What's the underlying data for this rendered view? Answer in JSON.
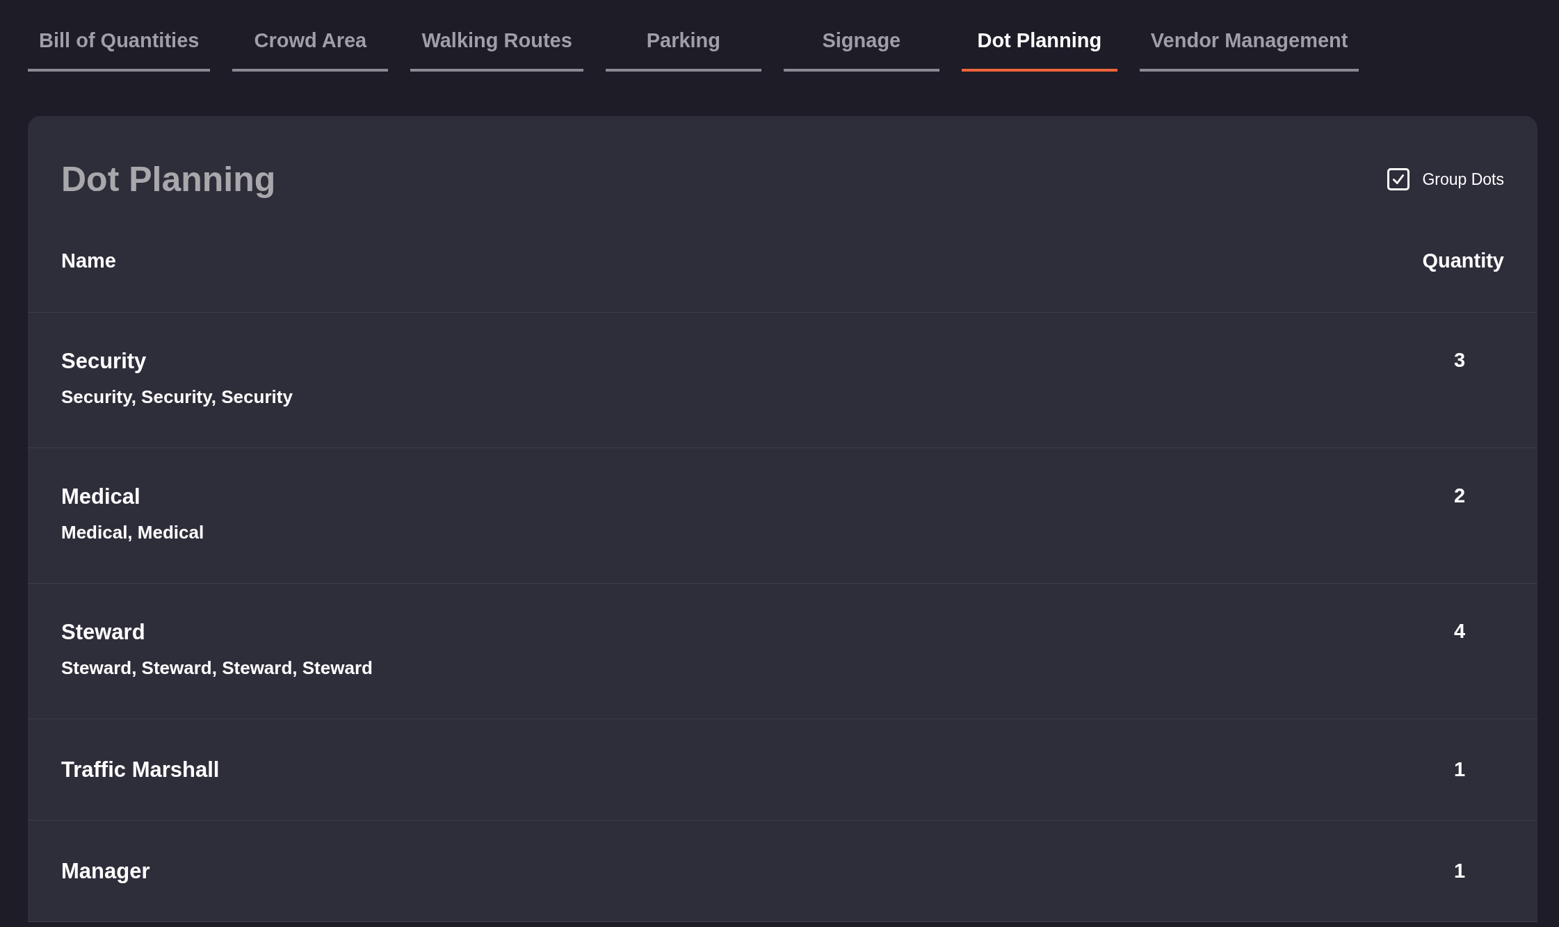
{
  "tabs": [
    {
      "label": "Bill of Quantities",
      "selected": false
    },
    {
      "label": "Crowd Area",
      "selected": false
    },
    {
      "label": "Walking Routes",
      "selected": false
    },
    {
      "label": "Parking",
      "selected": false
    },
    {
      "label": "Signage",
      "selected": false
    },
    {
      "label": "Dot Planning",
      "selected": true
    },
    {
      "label": "Vendor Management",
      "selected": false
    }
  ],
  "panel": {
    "title": "Dot Planning",
    "group_dots": {
      "label": "Group Dots",
      "checked": true
    },
    "columns": [
      "Name",
      "Quantity"
    ],
    "rows": [
      {
        "name": "Security",
        "details": "Security, Security, Security",
        "quantity": "3"
      },
      {
        "name": "Medical",
        "details": "Medical, Medical",
        "quantity": "2"
      },
      {
        "name": "Steward",
        "details": "Steward, Steward, Steward, Steward",
        "quantity": "4"
      },
      {
        "name": "Traffic Marshall",
        "quantity": "1"
      },
      {
        "name": "Manager",
        "quantity": "1"
      }
    ]
  }
}
